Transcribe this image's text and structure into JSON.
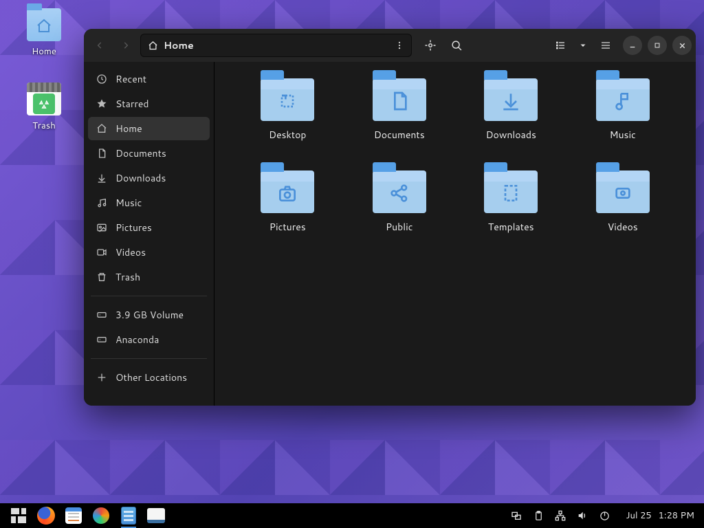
{
  "desktop_icons": [
    {
      "name": "home-desktop-icon",
      "label": "Home",
      "kind": "folder"
    },
    {
      "name": "trash-desktop-icon",
      "label": "Trash",
      "kind": "trash"
    }
  ],
  "window": {
    "path_label": "Home",
    "sidebar": {
      "places": [
        {
          "name": "recent",
          "label": "Recent",
          "icon": "clock"
        },
        {
          "name": "starred",
          "label": "Starred",
          "icon": "star"
        },
        {
          "name": "home",
          "label": "Home",
          "icon": "home",
          "active": true
        },
        {
          "name": "documents",
          "label": "Documents",
          "icon": "doc"
        },
        {
          "name": "downloads",
          "label": "Downloads",
          "icon": "down"
        },
        {
          "name": "music",
          "label": "Music",
          "icon": "music"
        },
        {
          "name": "pictures",
          "label": "Pictures",
          "icon": "pic"
        },
        {
          "name": "videos",
          "label": "Videos",
          "icon": "vid"
        },
        {
          "name": "trash",
          "label": "Trash",
          "icon": "trash"
        }
      ],
      "devices": [
        {
          "name": "volume",
          "label": "3.9 GB Volume",
          "icon": "drive"
        },
        {
          "name": "anaconda",
          "label": "Anaconda",
          "icon": "drive"
        }
      ],
      "other": {
        "name": "other-locations",
        "label": "Other Locations",
        "icon": "plus"
      }
    },
    "folders": [
      {
        "name": "desktop",
        "label": "Desktop",
        "glyph": "desktop"
      },
      {
        "name": "documents",
        "label": "Documents",
        "glyph": "doc"
      },
      {
        "name": "downloads",
        "label": "Downloads",
        "glyph": "down"
      },
      {
        "name": "music",
        "label": "Music",
        "glyph": "music"
      },
      {
        "name": "pictures",
        "label": "Pictures",
        "glyph": "pic"
      },
      {
        "name": "public",
        "label": "Public",
        "glyph": "share"
      },
      {
        "name": "templates",
        "label": "Templates",
        "glyph": "tmpl"
      },
      {
        "name": "videos",
        "label": "Videos",
        "glyph": "vid"
      }
    ]
  },
  "panel": {
    "date": "Jul 25",
    "time": "1:28 PM"
  }
}
